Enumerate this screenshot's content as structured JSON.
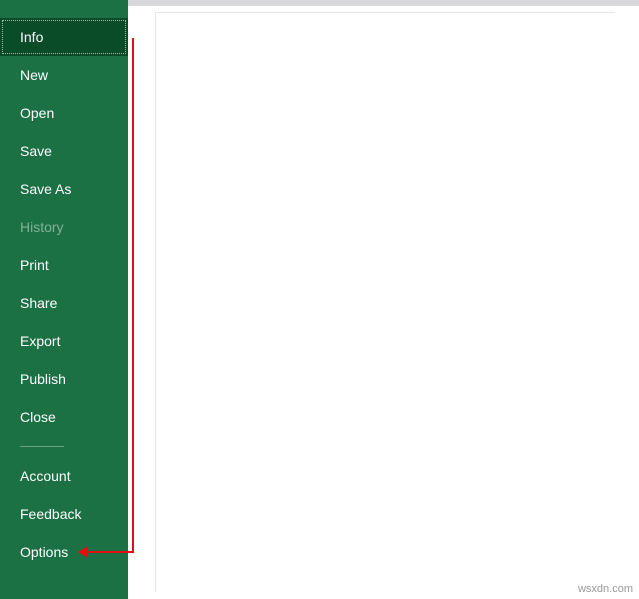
{
  "sidebar": {
    "items": [
      {
        "label": "Info",
        "selected": true,
        "disabled": false
      },
      {
        "label": "New",
        "selected": false,
        "disabled": false
      },
      {
        "label": "Open",
        "selected": false,
        "disabled": false
      },
      {
        "label": "Save",
        "selected": false,
        "disabled": false
      },
      {
        "label": "Save As",
        "selected": false,
        "disabled": false
      },
      {
        "label": "History",
        "selected": false,
        "disabled": true
      },
      {
        "label": "Print",
        "selected": false,
        "disabled": false
      },
      {
        "label": "Share",
        "selected": false,
        "disabled": false
      },
      {
        "label": "Export",
        "selected": false,
        "disabled": false
      },
      {
        "label": "Publish",
        "selected": false,
        "disabled": false
      },
      {
        "label": "Close",
        "selected": false,
        "disabled": false
      }
    ],
    "footer_items": [
      {
        "label": "Account"
      },
      {
        "label": "Feedback"
      },
      {
        "label": "Options"
      }
    ]
  },
  "watermark": "wsxdn.com",
  "colors": {
    "sidebar_bg": "#1b7044",
    "selected_bg": "#0a4b28",
    "annotation": "#e31010"
  }
}
